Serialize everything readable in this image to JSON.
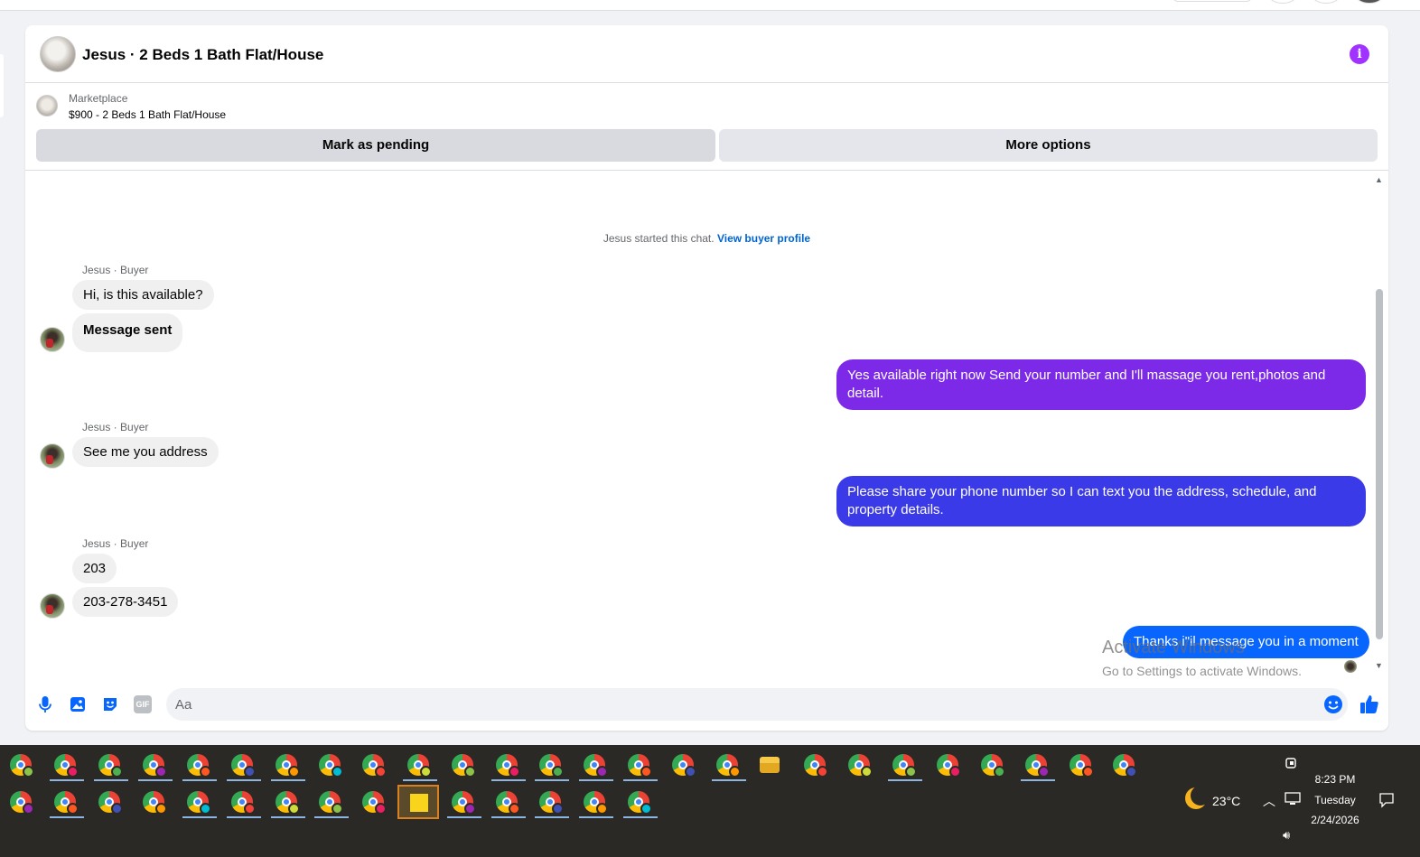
{
  "header": {
    "title": "Jesus · 2 Beds 1 Bath Flat/House"
  },
  "listing": {
    "kind": "Marketplace",
    "price_title": "$900 - 2 Beds 1 Bath Flat/House",
    "mark_pending_label": "Mark as pending",
    "more_options_label": "More options"
  },
  "chat": {
    "system_text": "Jesus started this chat.",
    "system_link": "View buyer profile",
    "messages": [
      {
        "direction": "in",
        "sender": "Jesus · Buyer",
        "text": "Hi, is this available?"
      },
      {
        "direction": "in",
        "text": "Message sent"
      },
      {
        "direction": "out",
        "text": "Yes available right now Send your number and I'll massage you rent,photos and detail."
      },
      {
        "direction": "in",
        "sender": "Jesus · Buyer",
        "text": "See me you address"
      },
      {
        "direction": "out",
        "text": "Please share your phone number so I can text you the address, schedule, and property details."
      },
      {
        "direction": "in",
        "sender": "Jesus · Buyer",
        "text": "203"
      },
      {
        "direction": "in",
        "text": "203-278-3451"
      },
      {
        "direction": "out",
        "text": "Thanks i\"il message you in a moment"
      }
    ]
  },
  "composer": {
    "placeholder": "Aa",
    "icons": [
      "microphone-icon",
      "photo-icon",
      "sticker-icon",
      "gif-icon",
      "emoji-icon",
      "thumbs-up-icon"
    ],
    "gif_label": "GIF"
  },
  "watermark": {
    "title": "Activate Windows",
    "subtitle": "Go to Settings to activate Windows."
  },
  "taskbar": {
    "weather": "23°C",
    "time": "8:23 PM",
    "day": "Tuesday",
    "date": "2/24/2026"
  },
  "colors": {
    "accent_purple": "#7d2ae8",
    "bubble_blue_violet": "#3b3ae8",
    "bubble_blue": "#0866ff",
    "info_purple": "#a033ff",
    "icon_blue": "#0866ff"
  }
}
